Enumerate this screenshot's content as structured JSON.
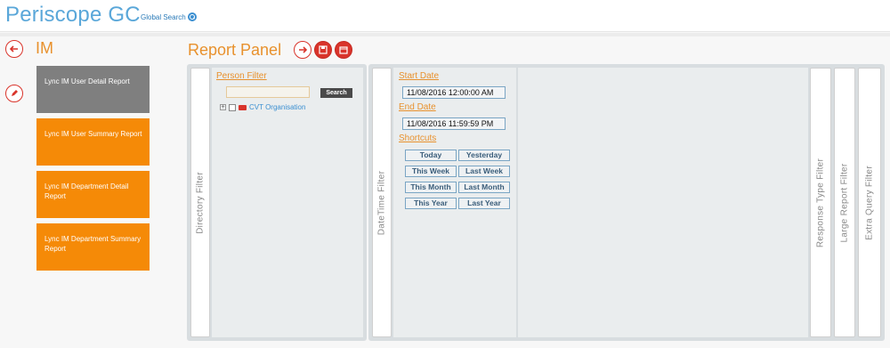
{
  "app": {
    "title": "Periscope GC",
    "global_search_label": "Global Search"
  },
  "sidebar": {
    "section_title": "IM",
    "reports": [
      {
        "label": "Lync IM User Detail Report",
        "active": true
      },
      {
        "label": "Lync IM User Summary Report",
        "active": false
      },
      {
        "label": "Lync IM Department Detail Report",
        "active": false
      },
      {
        "label": "Lync IM Department Summary Report",
        "active": false
      }
    ]
  },
  "report_panel": {
    "title": "Report Panel",
    "tabs": {
      "directory": "Directory Filter",
      "datetime": "DateTime Filter",
      "response_type": "Response Type Filter",
      "large_report": "Large Report Filter",
      "extra_query": "Extra Query Filter"
    },
    "person_filter": {
      "label": "Person Filter",
      "search_value": "",
      "search_button": "Search",
      "tree_root": "CVT Organisation"
    },
    "datetime": {
      "start_label": "Start Date",
      "start_value": "11/08/2016 12:00:00 AM",
      "end_label": "End Date",
      "end_value": "11/08/2016 11:59:59 PM",
      "shortcuts_label": "Shortcuts",
      "shortcuts": [
        "Today",
        "Yesterday",
        "This Week",
        "Last Week",
        "This Month",
        "Last Month",
        "This Year",
        "Last Year"
      ]
    }
  },
  "colors": {
    "accent_orange": "#f58a07",
    "active_gray": "#7f7f7f",
    "title_blue": "#5aa7d9",
    "icon_red": "#d9342b"
  }
}
